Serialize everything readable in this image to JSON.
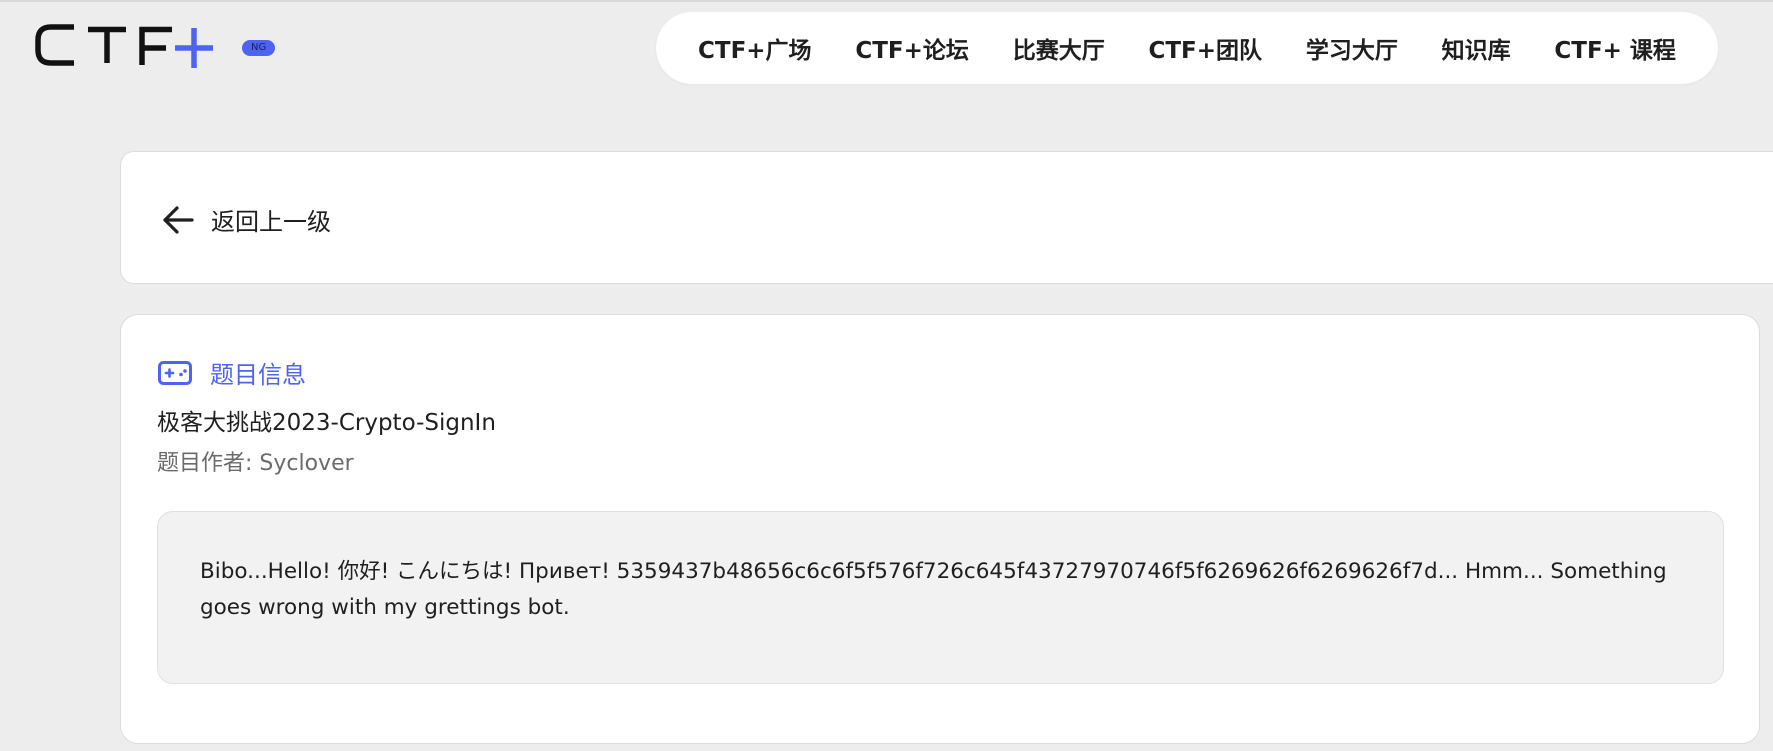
{
  "header": {
    "logo_text": "CTF+",
    "badge": "NG"
  },
  "nav": {
    "items": [
      {
        "label": "CTF+广场"
      },
      {
        "label": "CTF+论坛"
      },
      {
        "label": "比赛大厅"
      },
      {
        "label": "CTF+团队"
      },
      {
        "label": "学习大厅"
      },
      {
        "label": "知识库"
      },
      {
        "label": "CTF+ 课程"
      }
    ]
  },
  "back": {
    "label": "返回上一级",
    "icon": "arrow-left-icon"
  },
  "challenge": {
    "section_title": "题目信息",
    "section_icon": "gamepad-icon",
    "name": "极客大挑战2023-Crypto-SignIn",
    "author": "题目作者: Syclover",
    "description": "Bibo...Hello! 你好! こんにちは! Привет! 5359437b48656c6c6f5f576f726c645f43727970746f5f6269626f6269626f7d... Hmm... Something goes wrong with my grettings bot."
  },
  "colors": {
    "accent": "#4f63f2",
    "background": "#ededed",
    "card": "#ffffff"
  }
}
